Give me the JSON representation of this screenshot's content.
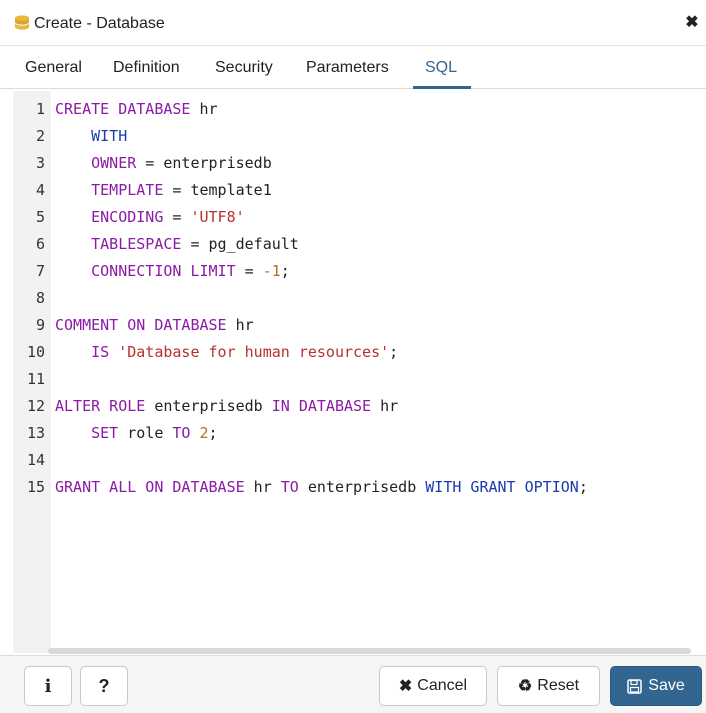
{
  "dialog": {
    "title": "Create - Database",
    "close_symbol": "✖"
  },
  "tabs": [
    {
      "label": "General"
    },
    {
      "label": "Definition"
    },
    {
      "label": "Security"
    },
    {
      "label": "Parameters"
    },
    {
      "label": "SQL",
      "active": true
    }
  ],
  "editor": {
    "lines": [
      {
        "num": "1"
      },
      {
        "num": "2"
      },
      {
        "num": "3"
      },
      {
        "num": "4"
      },
      {
        "num": "5"
      },
      {
        "num": "6"
      },
      {
        "num": "7"
      },
      {
        "num": "8"
      },
      {
        "num": "9"
      },
      {
        "num": "10"
      },
      {
        "num": "11"
      },
      {
        "num": "12"
      },
      {
        "num": "13"
      },
      {
        "num": "14"
      },
      {
        "num": "15"
      }
    ],
    "code": {
      "l1_kw": "CREATE DATABASE",
      "l1_rest": " hr",
      "l2_kw": "WITH",
      "l3_kw": "OWNER",
      "l3_rest": " = enterprisedb",
      "l4_kw": "TEMPLATE",
      "l4_rest": " = template1",
      "l5_kw": "ENCODING",
      "l5_rest": " = ",
      "l5_str": "'UTF8'",
      "l6_kw": "TABLESPACE",
      "l6_rest": " = pg_default",
      "l7_kw": "CONNECTION LIMIT",
      "l7_rest": " = ",
      "l7_num": "-1",
      "l7_end": ";",
      "l9_kw": "COMMENT ON DATABASE",
      "l9_rest": " hr",
      "l10_kw": "IS",
      "l10_rest": " ",
      "l10_str": "'Database for human resources'",
      "l10_end": ";",
      "l12_kw1": "ALTER ROLE",
      "l12_mid": " enterprisedb ",
      "l12_kw2": "IN DATABASE",
      "l12_rest": " hr",
      "l13_kw1": "SET",
      "l13_mid": " role ",
      "l13_kw2": "TO",
      "l13_sp": " ",
      "l13_num": "2",
      "l13_end": ";",
      "l15_kw1": "GRANT ALL ON DATABASE",
      "l15_mid": " hr ",
      "l15_kw2": "TO",
      "l15_mid2": " enterprisedb ",
      "l15_kw3": "WITH GRANT OPTION",
      "l15_end": ";"
    }
  },
  "footer": {
    "info_label": "i",
    "help_label": "?",
    "cancel_icon": "✖",
    "cancel_label": "Cancel",
    "reset_icon": "♻",
    "reset_label": "Reset",
    "save_icon": "🖫",
    "save_label": "Save"
  },
  "colors": {
    "accent": "#326690",
    "keyword": "#8b1aa5",
    "string": "#b8312f",
    "number": "#b86f1a"
  }
}
